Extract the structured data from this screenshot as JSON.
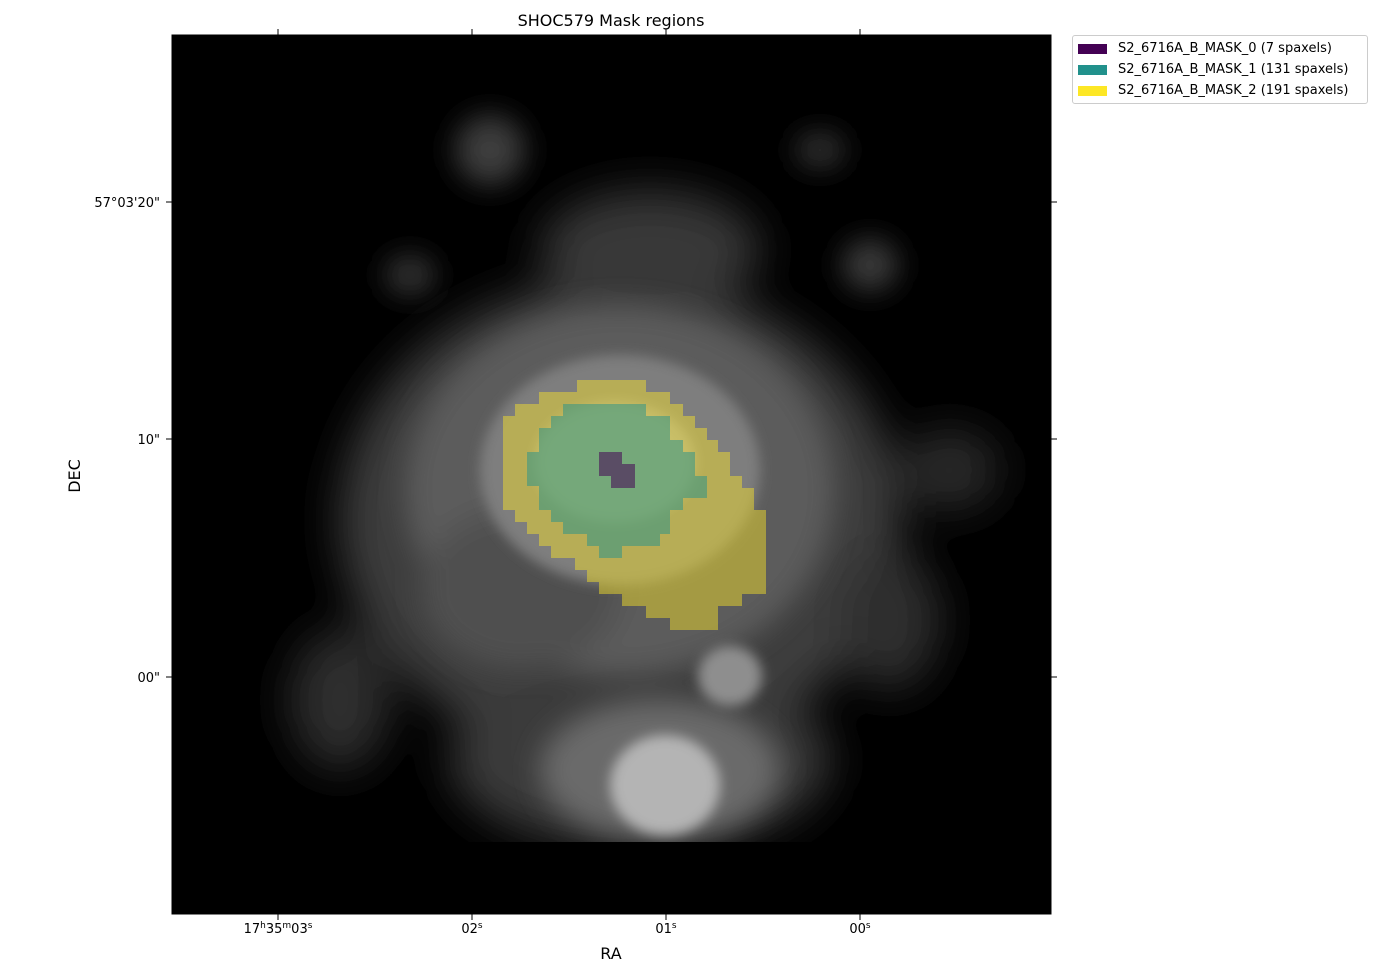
{
  "chart_data": {
    "type": "heatmap",
    "title": "SHOC579 Mask regions",
    "xlabel": "RA",
    "ylabel": "DEC",
    "colormap": "gray",
    "background_color": "#000000",
    "x_ticks": [
      {
        "label": "17h35m03s",
        "hours": "17",
        "minutes": "35",
        "seconds": "03",
        "value_s": 3
      },
      {
        "label": "02s",
        "seconds": "02",
        "value_s": 2
      },
      {
        "label": "01s",
        "seconds": "01",
        "value_s": 1
      },
      {
        "label": "00s",
        "seconds": "00",
        "value_s": 0
      }
    ],
    "y_ticks": [
      {
        "label": "57°03'20\"",
        "value_arcsec": 20
      },
      {
        "label": "10\"",
        "value_arcsec": 10
      },
      {
        "label": "00\"",
        "value_arcsec": 0
      }
    ],
    "series": [
      {
        "name": "S2_6716A_B_MASK_0 (7 spaxels)",
        "mask": "S2_6716A_B_MASK_0",
        "spaxels": 7,
        "color": "#440154"
      },
      {
        "name": "S2_6716A_B_MASK_1 (131 spaxels)",
        "mask": "S2_6716A_B_MASK_1",
        "spaxels": 131,
        "color": "#21918c"
      },
      {
        "name": "S2_6716A_B_MASK_2 (191 spaxels)",
        "mask": "S2_6716A_B_MASK_2",
        "spaxels": 191,
        "color": "#fde725"
      }
    ],
    "legend_position": "outside upper-right",
    "grid": false
  }
}
